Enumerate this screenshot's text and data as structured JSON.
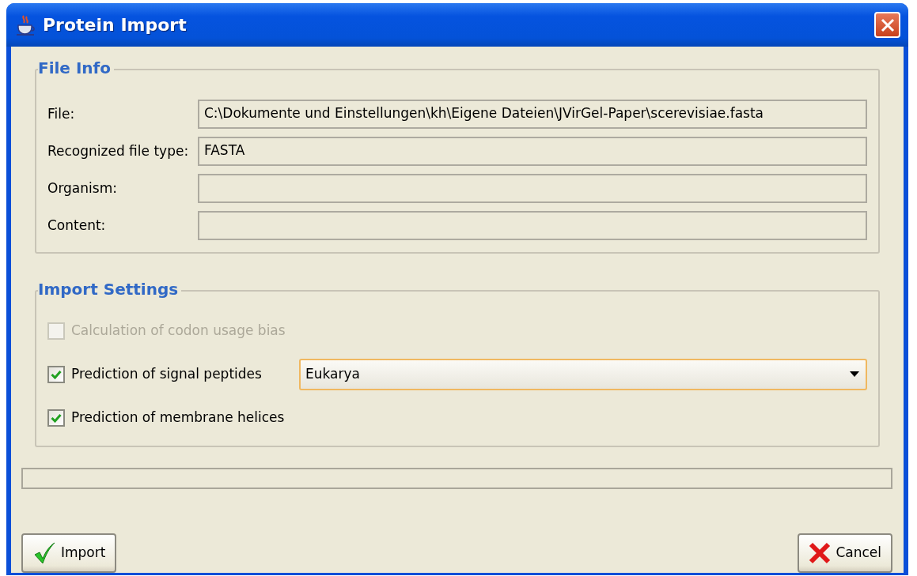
{
  "window": {
    "title": "Protein Import"
  },
  "file_info": {
    "title": "File Info",
    "fields": [
      {
        "label": "File:",
        "value": "C:\\Dokumente und Einstellungen\\kh\\Eigene Dateien\\JVirGel-Paper\\scerevisiae.fasta"
      },
      {
        "label": "Recognized file type:",
        "value": "FASTA"
      },
      {
        "label": "Organism:"
      },
      {
        "label": "Content:"
      }
    ]
  },
  "import_settings": {
    "title": "Import Settings",
    "options": [
      {
        "label": "Calculation of codon usage bias",
        "checked": false,
        "disabled": true
      },
      {
        "label": "Prediction of signal peptides",
        "checked": true,
        "disabled": false,
        "dropdown": {
          "value": "Eukarya"
        }
      },
      {
        "label": "Prediction of membrane helices",
        "checked": true,
        "disabled": false
      }
    ]
  },
  "progress": {
    "level": 0
  },
  "buttons": [
    {
      "label": "Import",
      "kind": "ok"
    },
    {
      "label": "Cancel",
      "kind": "cancel"
    }
  ]
}
